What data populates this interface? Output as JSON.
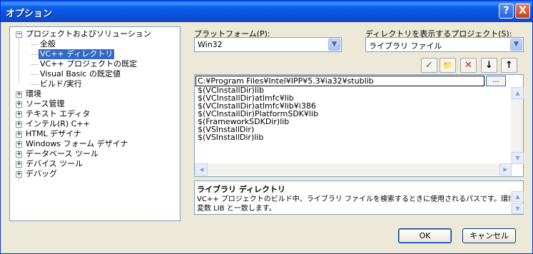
{
  "window": {
    "title": "オプション",
    "help_glyph": "?",
    "close_glyph": "X"
  },
  "tree": {
    "items": [
      {
        "label": "プロジェクトおよびソリューション",
        "expander": "−"
      },
      {
        "label": "全般"
      },
      {
        "label": "VC++ ディレクトリ",
        "selected": true
      },
      {
        "label": "VC++ プロジェクトの既定"
      },
      {
        "label": "Visual Basic の既定値"
      },
      {
        "label": "ビルド/実行"
      },
      {
        "label": "環境",
        "expander": "+"
      },
      {
        "label": "ソース管理",
        "expander": "+"
      },
      {
        "label": "テキスト エディタ",
        "expander": "+"
      },
      {
        "label": "インテル(R) C++",
        "expander": "+"
      },
      {
        "label": "HTML デザイナ",
        "expander": "+"
      },
      {
        "label": "Windows フォーム デザイナ",
        "expander": "+"
      },
      {
        "label": "データベース ツール",
        "expander": "+"
      },
      {
        "label": "デバイス ツール",
        "expander": "+"
      },
      {
        "label": "デバッグ",
        "expander": "+"
      }
    ]
  },
  "platform": {
    "label": "プラットフォーム(P):",
    "value": "Win32"
  },
  "directory": {
    "label": "ディレクトリを表示するプロジェクト(S):",
    "value": "ライブラリ ファイル"
  },
  "toolbar": {
    "check_glyph": "✓",
    "newfolder_glyph": "📁",
    "delete_glyph": "✕",
    "down_glyph": "↓",
    "up_glyph": "↑"
  },
  "paths": {
    "editing": "C:¥Program Files¥Intel¥IPP¥5.3¥ia32¥stublib",
    "browse_label": "...",
    "items": [
      "$(VCInstallDir)lib",
      "$(VCInstallDir)atlmfc¥lib",
      "$(VCInstallDir)atlmfc¥lib¥i386",
      "$(VCInstallDir)PlatformSDK¥lib",
      "$(FrameworkSDKDir)lib",
      "$(VSInstallDir)",
      "$(VSInstallDir)lib"
    ]
  },
  "description": {
    "title": "ライブラリ ディレクトリ",
    "line1": "VC++ プロジェクトのビルド中、ライブラリ ファイルを検索するときに使用されるパスです。環境",
    "line2": "変数 LIB と一致します。"
  },
  "buttons": {
    "ok": "OK",
    "cancel": "キャンセル"
  }
}
